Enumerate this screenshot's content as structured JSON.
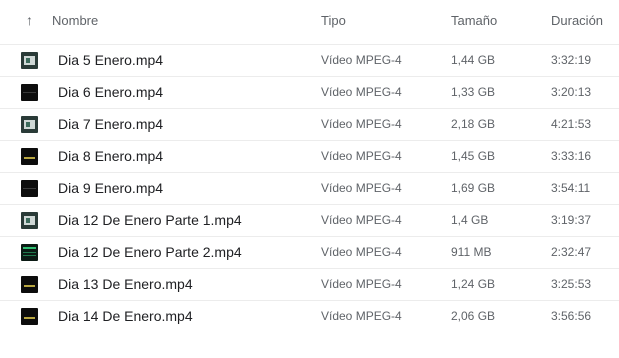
{
  "header": {
    "sort_icon": "arrow-up-icon",
    "name": "Nombre",
    "type": "Tipo",
    "size": "Tamaño",
    "duration": "Duración"
  },
  "files": [
    {
      "name": "Dia 5 Enero.mp4",
      "type": "Vídeo MPEG-4",
      "size": "1,44 GB",
      "duration": "3:32:19",
      "thumb": "type-a"
    },
    {
      "name": "Dia 6 Enero.mp4",
      "type": "Vídeo MPEG-4",
      "size": "1,33 GB",
      "duration": "3:20:13",
      "thumb": "type-b"
    },
    {
      "name": "Dia 7 Enero.mp4",
      "type": "Vídeo MPEG-4",
      "size": "2,18 GB",
      "duration": "4:21:53",
      "thumb": "type-a"
    },
    {
      "name": "Dia 8 Enero.mp4",
      "type": "Vídeo MPEG-4",
      "size": "1,45 GB",
      "duration": "3:33:16",
      "thumb": "type-d"
    },
    {
      "name": "Dia 9 Enero.mp4",
      "type": "Vídeo MPEG-4",
      "size": "1,69 GB",
      "duration": "3:54:11",
      "thumb": "type-b"
    },
    {
      "name": "Dia 12 De Enero Parte 1.mp4",
      "type": "Vídeo MPEG-4",
      "size": "1,4 GB",
      "duration": "3:19:37",
      "thumb": "type-a"
    },
    {
      "name": "Dia 12 De Enero Parte 2.mp4",
      "type": "Vídeo MPEG-4",
      "size": "911 MB",
      "duration": "2:32:47",
      "thumb": "type-c"
    },
    {
      "name": "Dia 13 De Enero.mp4",
      "type": "Vídeo MPEG-4",
      "size": "1,24 GB",
      "duration": "3:25:53",
      "thumb": "type-d"
    },
    {
      "name": "Dia 14 De Enero.mp4",
      "type": "Vídeo MPEG-4",
      "size": "2,06 GB",
      "duration": "3:56:56",
      "thumb": "type-d"
    }
  ]
}
